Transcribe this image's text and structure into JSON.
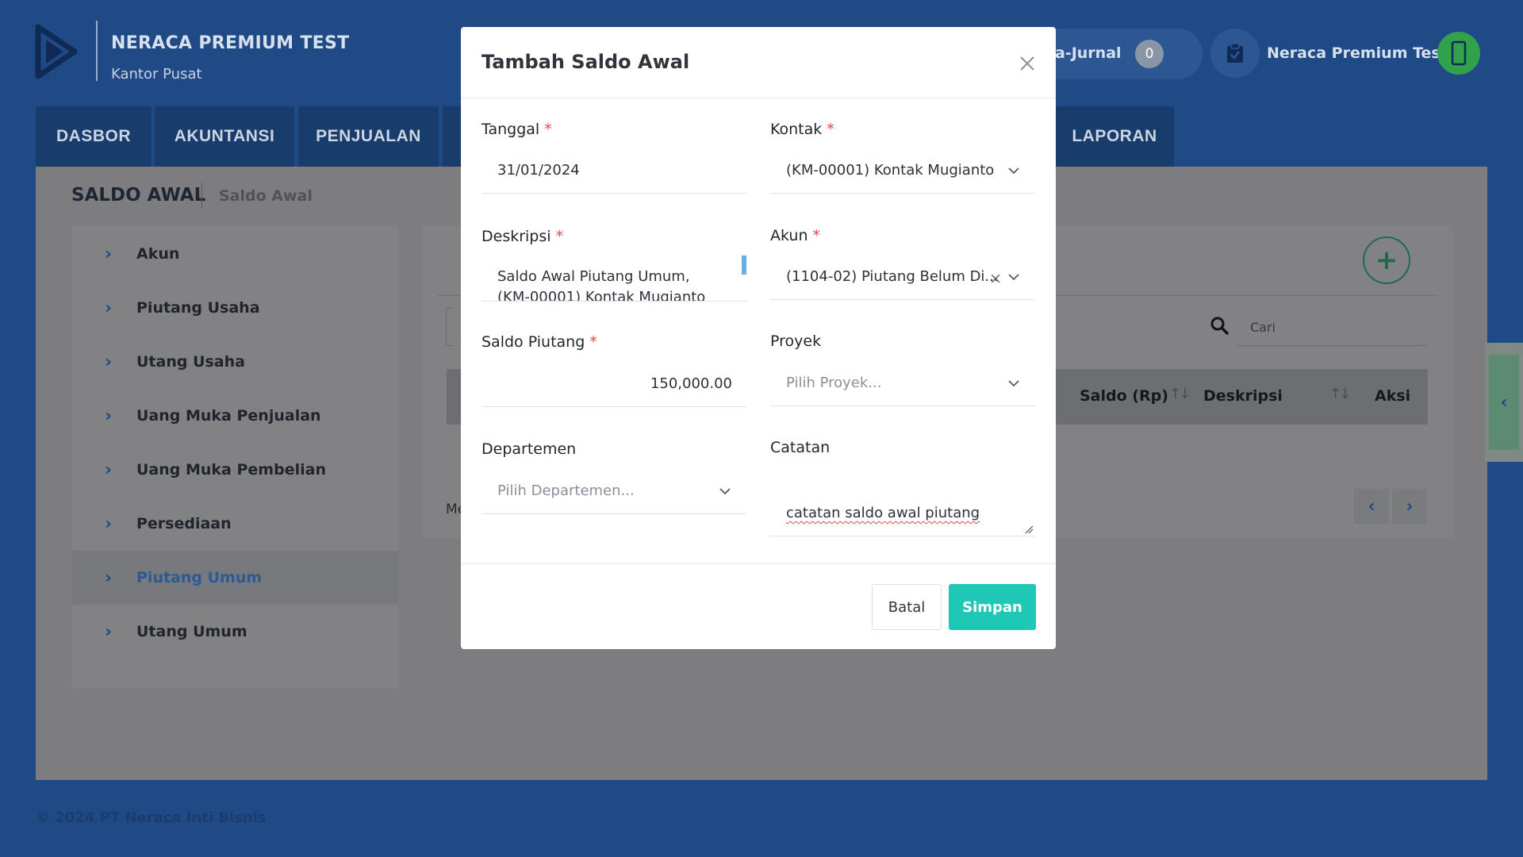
{
  "header": {
    "company_name": "NERACA PREMIUM TEST",
    "branch": "Kantor Pusat",
    "ejurnal_label": "a-Jurnal",
    "ejurnal_count": "0",
    "user_name": "Neraca Premium Test"
  },
  "nav": {
    "tabs": [
      {
        "label": "DASBOR"
      },
      {
        "label": "AKUNTANSI"
      },
      {
        "label": "PENJUALAN"
      },
      {
        "label": "LAPORAN"
      }
    ]
  },
  "page": {
    "title": "SALDO AWAL",
    "breadcrumb": "Saldo Awal"
  },
  "sidebar": {
    "items": [
      {
        "label": "Akun"
      },
      {
        "label": "Piutang Usaha"
      },
      {
        "label": "Utang Usaha"
      },
      {
        "label": "Uang Muka Penjualan"
      },
      {
        "label": "Uang Muka Pembelian"
      },
      {
        "label": "Persediaan"
      },
      {
        "label": "Piutang Umum"
      },
      {
        "label": "Utang Umum"
      }
    ],
    "active_index": 6
  },
  "table": {
    "search_placeholder": "Cari",
    "columns": [
      "Saldo (Rp)",
      "Deskripsi",
      "Aksi"
    ],
    "info_text": "Me"
  },
  "footer": {
    "copyright": "© 2024 PT Neraca Inti Bisnis"
  },
  "modal": {
    "title": "Tambah Saldo Awal",
    "fields": {
      "tanggal": {
        "label": "Tanggal",
        "value": "31/01/2024"
      },
      "kontak": {
        "label": "Kontak",
        "value": "(KM-00001) Kontak Mugianto"
      },
      "deskripsi": {
        "label": "Deskripsi",
        "value": "Saldo Awal Piutang Umum,",
        "value_line2": "(KM-00001) Kontak Mugianto"
      },
      "akun": {
        "label": "Akun",
        "value": "(1104-02) Piutang Belum Di..."
      },
      "saldo_piutang": {
        "label": "Saldo Piutang",
        "value": "150,000.00"
      },
      "proyek": {
        "label": "Proyek",
        "placeholder": "Pilih Proyek..."
      },
      "departemen": {
        "label": "Departemen",
        "placeholder": "Pilih Departemen..."
      },
      "catatan": {
        "label": "Catatan",
        "value": "catatan saldo awal piutang"
      }
    },
    "required_mark": "*",
    "cancel_label": "Batal",
    "save_label": "Simpan"
  },
  "colors": {
    "brand_blue": "#1f4a85",
    "save_button": "#1fc8b4",
    "required": "#e04a4a",
    "overlay_gray": "#7d7d7f"
  },
  "icons": [
    "logo-icon",
    "clipboard-check-icon",
    "phone-icon",
    "chevron-right-icon",
    "plus-icon",
    "search-icon",
    "sort-icon",
    "chevron-left-icon",
    "close-icon",
    "chevron-down-icon",
    "clear-icon"
  ]
}
